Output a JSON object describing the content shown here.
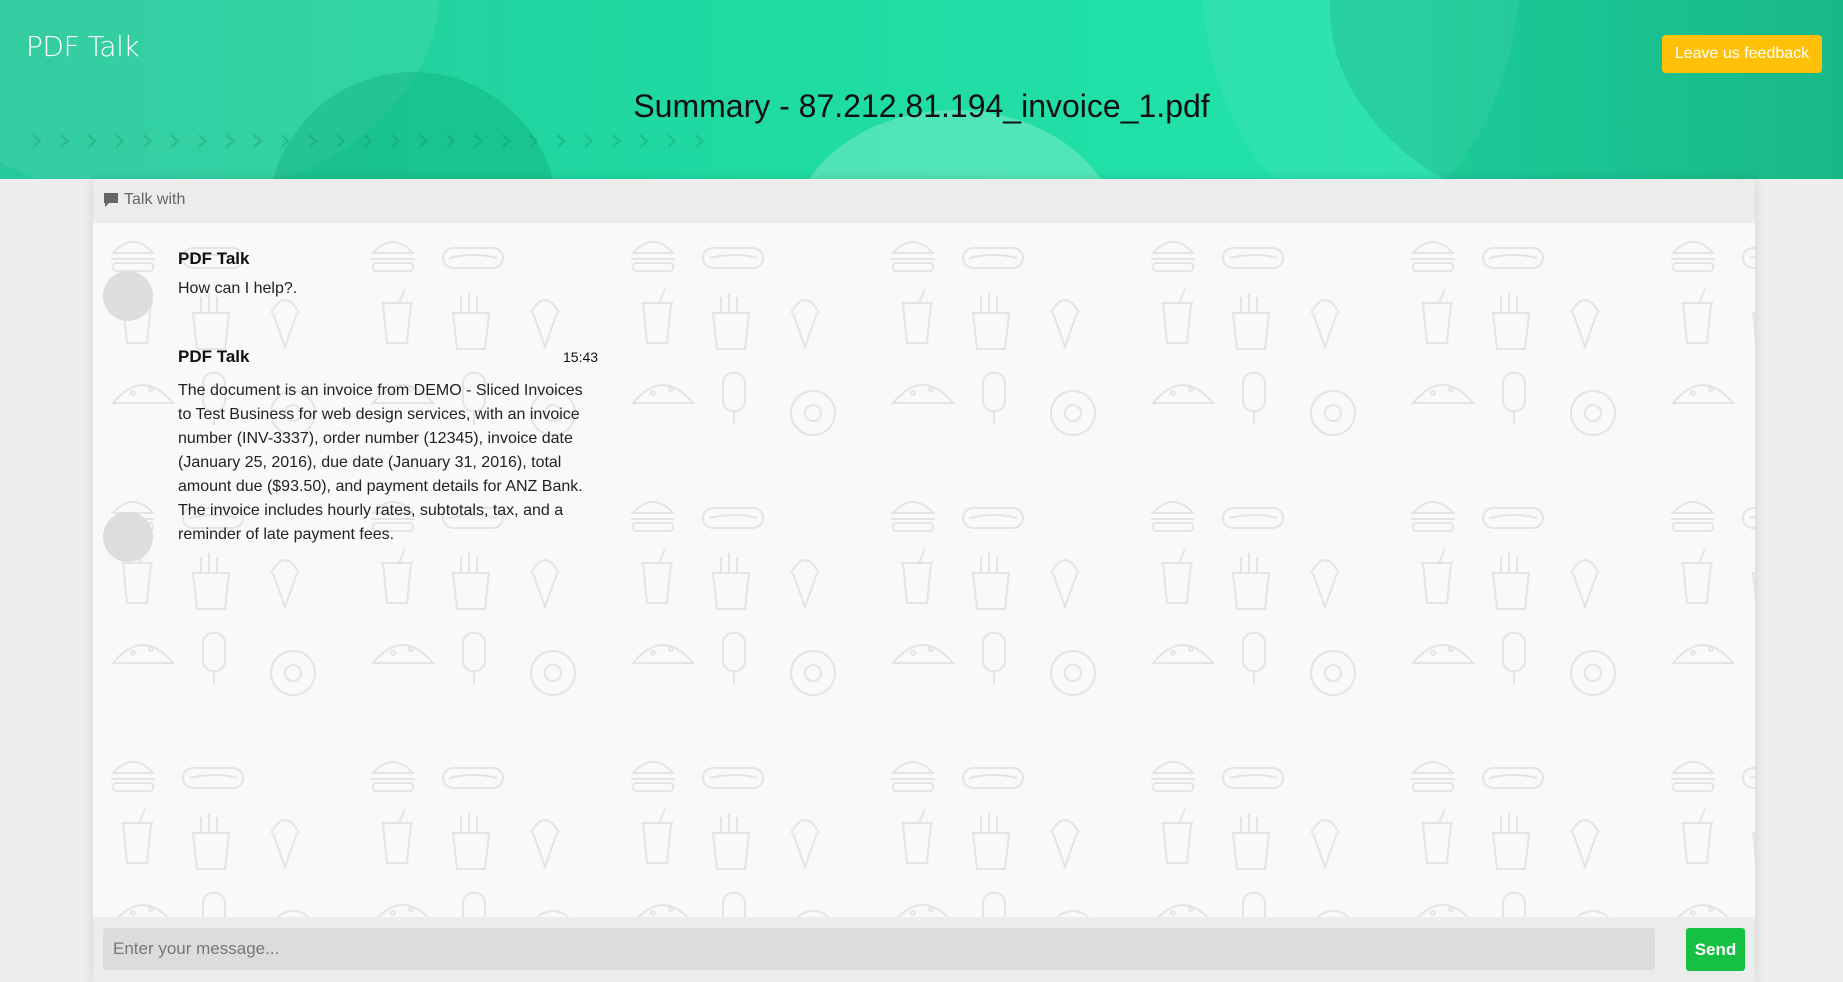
{
  "header": {
    "brand": "PDF Talk",
    "feedback_label": "Leave us feedback",
    "title": "Summary - 87.212.81.194_invoice_1.pdf"
  },
  "chat": {
    "header_icon": "comment-icon",
    "header_label": "Talk with",
    "messages": [
      {
        "sender": "PDF Talk",
        "time": "",
        "text": "How can I help?."
      },
      {
        "sender": "PDF Talk",
        "time": "15:43",
        "text": "The document is an invoice from DEMO - Sliced Invoices to Test Business for web design services, with an invoice number (INV-3337), order number (12345), invoice date (January 25, 2016), due date (January 31, 2016), total amount due ($93.50), and payment details for ANZ Bank. The invoice includes hourly rates, subtotals, tax, and a reminder of late payment fees."
      }
    ],
    "input_placeholder": "Enter your message...",
    "send_label": "Send"
  },
  "colors": {
    "hero": "#1fdca3",
    "feedback": "#ffc107",
    "send": "#16c040",
    "avatar": "#dddddd"
  }
}
